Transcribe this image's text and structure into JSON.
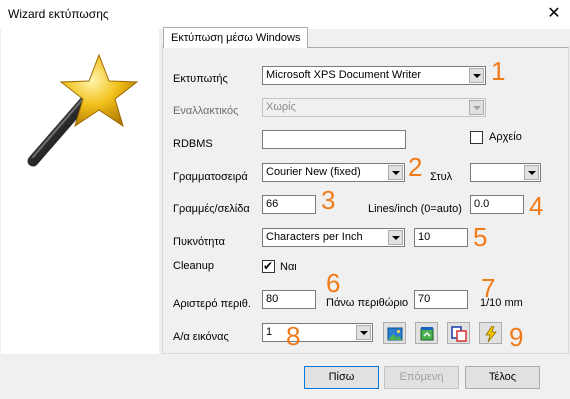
{
  "window": {
    "title": "Wizard εκτύπωσης",
    "close_glyph": "✕"
  },
  "tab": {
    "label": "Εκτύπωση μέσω Windows"
  },
  "fields": {
    "printer_label": "Εκτυπωτής",
    "printer_value": "Microsoft XPS Document Writer",
    "alt_label": "Εναλλακτικός",
    "alt_value": "Χωρίς",
    "rdbms_label": "RDBMS",
    "rdbms_value": "",
    "file_label": "Αρχείο",
    "font_label": "Γραμματοσειρά",
    "font_value": "Courier New (fixed)",
    "style_label": "Στυλ",
    "style_value": "",
    "lines_label": "Γραμμές/σελίδα",
    "lines_value": "66",
    "lpi_label": "Lines/inch (0=auto)",
    "lpi_value": "0.0",
    "density_label": "Πυκνότητα",
    "density_value": "Characters per Inch",
    "density_number": "10",
    "cleanup_label": "Cleanup",
    "cleanup_check_label": "Ναι",
    "left_margin_label": "Αριστερό περιθ.",
    "left_margin_value": "80",
    "top_margin_label": "Πάνω περιθώριο",
    "top_margin_value": "70",
    "unit_label": "1/10 mm",
    "image_label": "Α/α εικόνας",
    "image_value": "1"
  },
  "annotations": [
    "1",
    "2",
    "3",
    "4",
    "5",
    "6",
    "7",
    "8",
    "9"
  ],
  "buttons": {
    "back": "Πίσω",
    "next": "Επόμενη",
    "finish": "Τέλος"
  },
  "colors": {
    "annotation": "#f07b1a"
  }
}
